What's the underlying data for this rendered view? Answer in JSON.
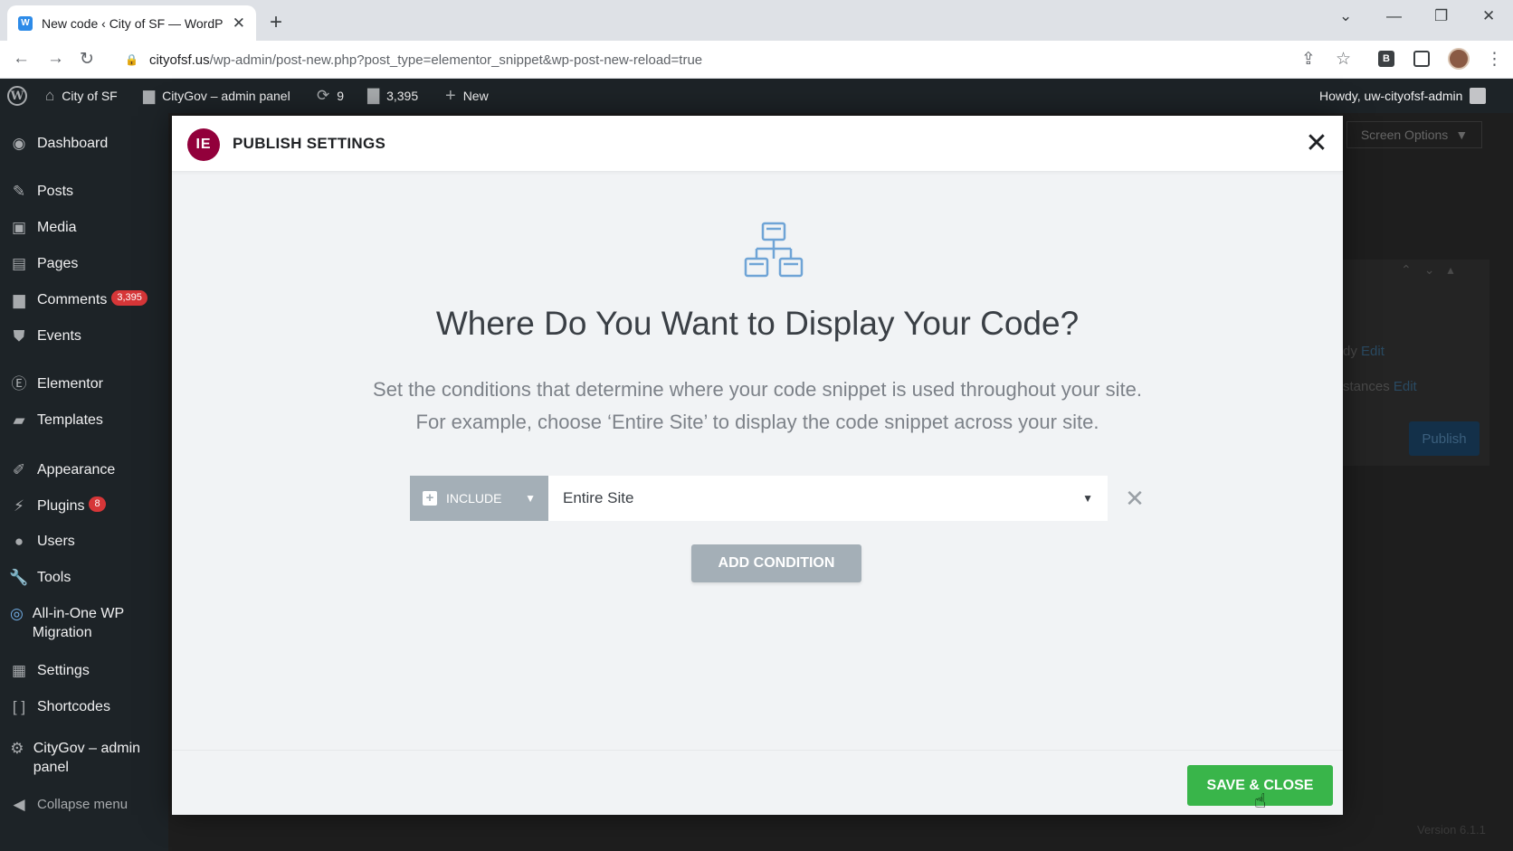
{
  "browser": {
    "tab_title": "New code ‹ City of SF — WordPr",
    "tab_favicon": "W",
    "url_host": "cityofsf.us",
    "url_path": "/wp-admin/post-new.php?post_type=elementor_snippet&wp-post-new-reload=true",
    "extension_label": "B"
  },
  "adminbar": {
    "site_name": "City of SF",
    "panel_name": "CityGov – admin panel",
    "updates_count": "9",
    "comments_count": "3,395",
    "new_label": "New",
    "howdy": "Howdy, uw-cityofsf-admin"
  },
  "sidebar": {
    "items": [
      {
        "label": "Dashboard",
        "icon": "dashboard-icon"
      },
      {
        "label": "Posts",
        "icon": "pin-icon"
      },
      {
        "label": "Media",
        "icon": "media-icon"
      },
      {
        "label": "Pages",
        "icon": "pages-icon"
      },
      {
        "label": "Comments",
        "icon": "comment-icon",
        "badge": "3,395"
      },
      {
        "label": "Events",
        "icon": "events-icon"
      },
      {
        "label": "Elementor",
        "icon": "elementor-icon"
      },
      {
        "label": "Templates",
        "icon": "folder-icon"
      },
      {
        "label": "Appearance",
        "icon": "brush-icon"
      },
      {
        "label": "Plugins",
        "icon": "plugin-icon",
        "badge": "8"
      },
      {
        "label": "Users",
        "icon": "user-icon"
      },
      {
        "label": "Tools",
        "icon": "wrench-icon"
      },
      {
        "label": "All-in-One WP Migration",
        "icon": "migration-icon"
      },
      {
        "label": "Settings",
        "icon": "settings-icon"
      },
      {
        "label": "Shortcodes",
        "icon": "brackets-icon"
      },
      {
        "label": "CityGov – admin panel",
        "icon": "gear-icon"
      }
    ],
    "collapse_label": "Collapse menu"
  },
  "background": {
    "screen_options": "Screen Options",
    "link_1_text": "dy",
    "link_1_action": "Edit",
    "link_2_text": "stances",
    "link_2_action": "Edit",
    "publish": "Publish",
    "version": "Version 6.1.1"
  },
  "modal": {
    "logo": "IE",
    "title": "PUBLISH SETTINGS",
    "headline": "Where Do You Want to Display Your Code?",
    "description_line1": "Set the conditions that determine where your code snippet is used throughout your site.",
    "description_line2": "For example, choose ‘Entire Site’ to display the code snippet across your site.",
    "condition": {
      "type_label": "INCLUDE",
      "selected_value": "Entire Site"
    },
    "add_condition_label": "ADD CONDITION",
    "save_close_label": "SAVE & CLOSE"
  },
  "colors": {
    "wp_dark": "#1d2327",
    "elementor_brand": "#92003b",
    "save_green": "#39b54a",
    "neutral_button": "#a4afb7",
    "badge_red": "#d63638"
  }
}
